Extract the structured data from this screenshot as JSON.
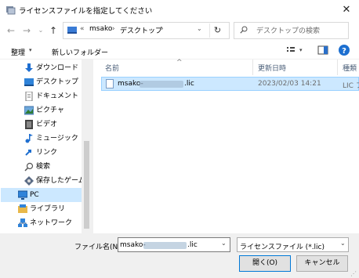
{
  "window": {
    "title": "ライセンスファイルを指定してください"
  },
  "address": {
    "prefix": "«",
    "segment1": "msako",
    "segment2": "デスクトップ",
    "sep": "›"
  },
  "search": {
    "placeholder": "デスクトップの検索"
  },
  "commands": {
    "organize": "整理",
    "new_folder": "新しいフォルダー"
  },
  "nav": {
    "items": [
      {
        "label": "ダウンロード",
        "icon": "download-icon"
      },
      {
        "label": "デスクトップ",
        "icon": "desktop-icon"
      },
      {
        "label": "ドキュメント",
        "icon": "document-icon"
      },
      {
        "label": "ピクチャ",
        "icon": "pictures-icon"
      },
      {
        "label": "ビデオ",
        "icon": "video-icon"
      },
      {
        "label": "ミュージック",
        "icon": "music-icon"
      },
      {
        "label": "リンク",
        "icon": "link-icon"
      },
      {
        "label": "検索",
        "icon": "search-icon"
      },
      {
        "label": "保存したゲーム",
        "icon": "games-icon"
      },
      {
        "label": "PC",
        "icon": "pc-icon"
      },
      {
        "label": "ライブラリ",
        "icon": "library-icon"
      },
      {
        "label": "ネットワーク",
        "icon": "network-icon"
      }
    ]
  },
  "columns": {
    "name": "名前",
    "modified": "更新日時",
    "type": "種類"
  },
  "files": [
    {
      "name_prefix": "msako-",
      "name_suffix": ".lic",
      "modified": "2023/02/03 14:21",
      "type": "LIC フ"
    }
  ],
  "filename": {
    "label": "ファイル名(N):",
    "value_prefix": "msako-",
    "value_suffix": ".lic"
  },
  "filter": {
    "value": "ライセンスファイル (*.lic)"
  },
  "buttons": {
    "open": "開く(O)",
    "cancel": "キャンセル"
  }
}
